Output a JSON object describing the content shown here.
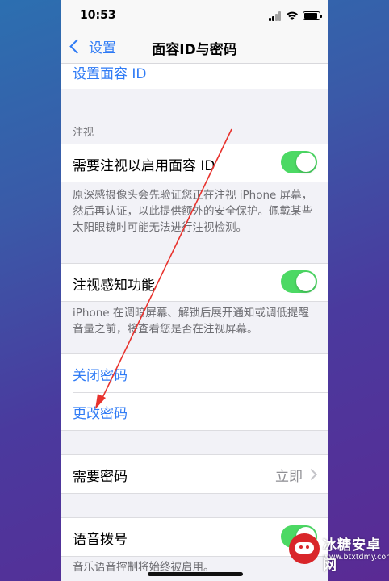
{
  "status_bar": {
    "time": "10:53"
  },
  "nav": {
    "back_label": "设置",
    "title": "面容ID与密码"
  },
  "rows": {
    "setup_face_id": "设置面容 ID",
    "attention_header": "注视",
    "require_attention": {
      "label": "需要注视以启用面容 ID",
      "on": true
    },
    "require_attention_footer": "原深感摄像头会先验证您正在注视 iPhone 屏幕，然后再认证，以此提供额外的安全保护。佩戴某些太阳眼镜时可能无法进行注视检测。",
    "attention_aware": {
      "label": "注视感知功能",
      "on": true
    },
    "attention_aware_footer": "iPhone 在调暗屏幕、解锁后展开通知或调低提醒音量之前，将查看您是否在注视屏幕。",
    "turn_off_passcode": "关闭密码",
    "change_passcode": "更改密码",
    "require_passcode": {
      "label": "需要密码",
      "value": "立即"
    },
    "voice_dial": {
      "label": "语音拨号",
      "on": true
    },
    "voice_dial_footer": "音乐语音控制将始终被启用。"
  },
  "watermark": {
    "name": "冰糖安卓网",
    "url": "www.btxtdmy.com"
  },
  "colors": {
    "accent": "#2f7bf5",
    "toggle_on": "#4cd964",
    "arrow": "#e8322d"
  }
}
